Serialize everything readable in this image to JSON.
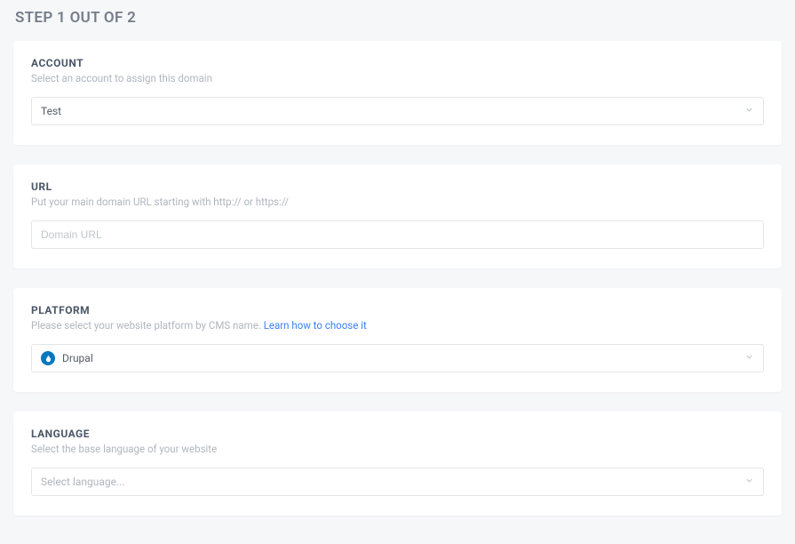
{
  "step_title": "STEP 1 OUT OF 2",
  "account": {
    "label": "ACCOUNT",
    "helper": "Select an account to assign this domain",
    "value": "Test"
  },
  "url": {
    "label": "URL",
    "helper": "Put your main domain URL starting with http:// or https://",
    "placeholder": "Domain URL"
  },
  "platform": {
    "label": "PLATFORM",
    "helper_prefix": "Please select your website platform by CMS name.  ",
    "helper_link": "Learn how to choose it",
    "value": "Drupal"
  },
  "language": {
    "label": "LANGUAGE",
    "helper": "Select the base language of your website",
    "placeholder": "Select language..."
  }
}
